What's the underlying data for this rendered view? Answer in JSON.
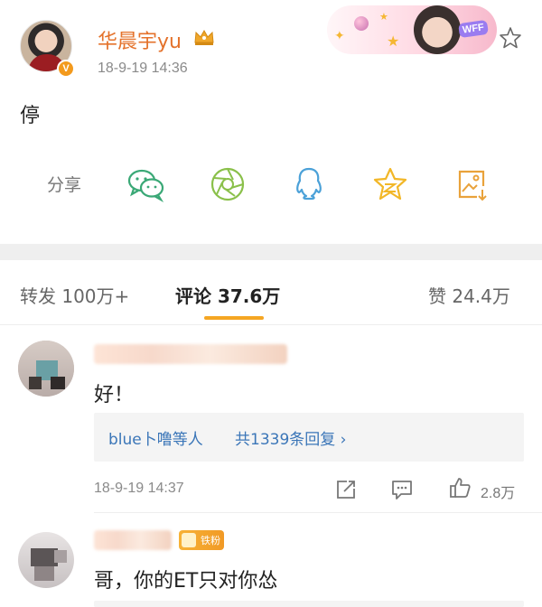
{
  "post": {
    "username": "华晨宇yu",
    "timestamp": "18-9-19 14:36",
    "badge": "V",
    "text": "停",
    "accent_color": "#e4722b"
  },
  "share": {
    "label": "分享",
    "buttons": [
      "wechat-icon",
      "moments-icon",
      "qq-icon",
      "qzone-icon",
      "save-image-icon"
    ]
  },
  "tabs": [
    {
      "label": "转发 100万+"
    },
    {
      "label": "评论 37.6万",
      "active": true
    },
    {
      "label": "赞 24.4万"
    }
  ],
  "comments": [
    {
      "text": "好！",
      "reply": {
        "user": "blue卜噜等人",
        "count": "共1339条回复 ›"
      },
      "time": "18-9-19 14:37",
      "likes": "2.8万"
    },
    {
      "text": "哥，你的ET只对你怂",
      "fan_badge": "铁粉"
    }
  ]
}
